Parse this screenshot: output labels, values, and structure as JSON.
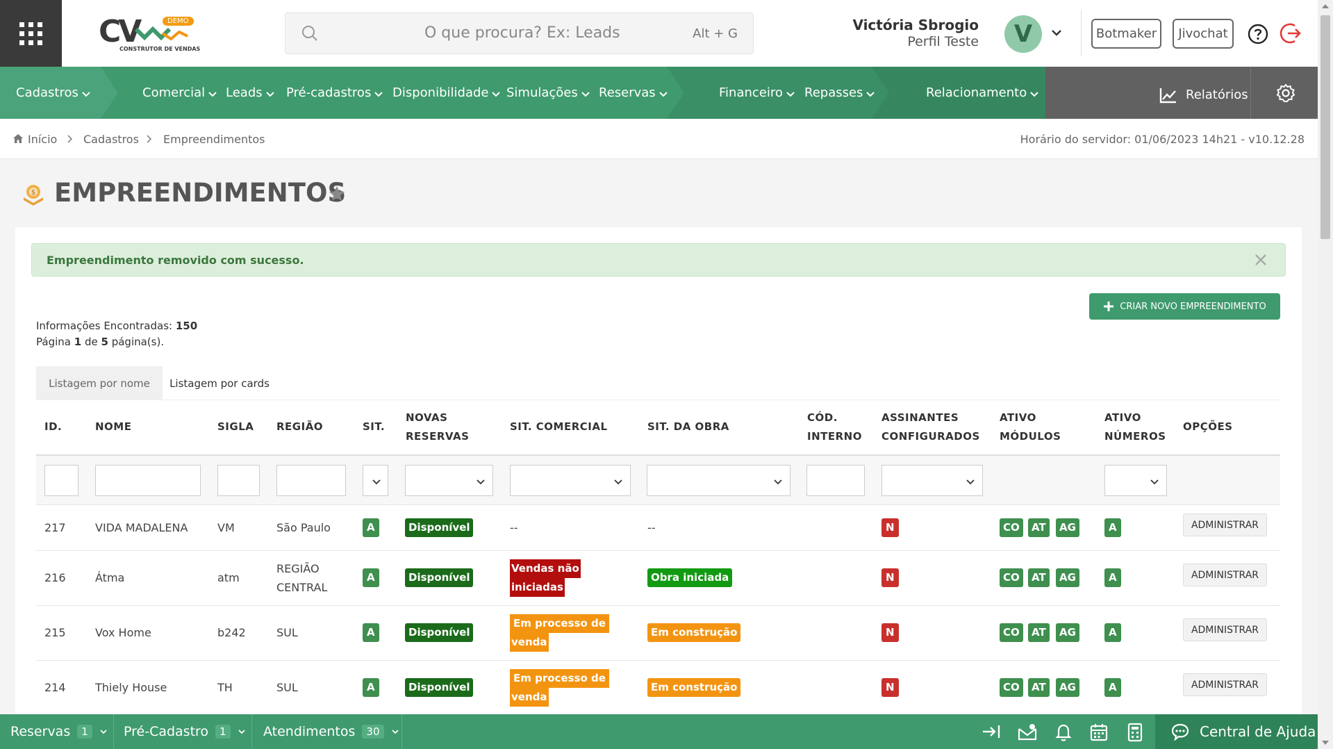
{
  "colors": {
    "brand_green": "#3f9a6e",
    "dark": "#3a3a3a",
    "nav_gray": "#616161",
    "danger": "#c9302c",
    "orange": "#f39411"
  },
  "header": {
    "logo_text": "CV",
    "logo_badge": "DEMO",
    "logo_subtitle": "CONSTRUTOR DE VENDAS",
    "search_placeholder": "O que procura? Ex: Leads",
    "search_shortcut": "Alt + G",
    "user_name": "Victória Sbrogio",
    "user_profile": "Perfil Teste",
    "avatar_initial": "V",
    "btn_botmaker": "Botmaker",
    "btn_jivochat": "Jivochat"
  },
  "nav": {
    "items": [
      {
        "label": "Cadastros"
      },
      {
        "label": "Comercial"
      },
      {
        "label": "Leads"
      },
      {
        "label": "Pré-cadastros"
      },
      {
        "label": "Disponibilidade"
      },
      {
        "label": "Simulações"
      },
      {
        "label": "Reservas"
      },
      {
        "label": "Financeiro"
      },
      {
        "label": "Repasses"
      },
      {
        "label": "Relacionamento"
      }
    ],
    "reports_label": "Relatórios"
  },
  "breadcrumb": {
    "home": "Início",
    "level1": "Cadastros",
    "level2": "Empreendimentos"
  },
  "server_time": "Horário do servidor: 01/06/2023 14h21 - v10.12.28",
  "page": {
    "title": "EMPREENDIMENTOS",
    "alert": "Empreendimento removido com sucesso.",
    "create_button": "CRIAR NOVO EMPREENDIMENTO",
    "info_found_label": "Informações Encontradas:",
    "info_found_value": "150",
    "page_word": "Página",
    "page_current": "1",
    "page_of": "de",
    "page_total": "5",
    "page_suffix": "página(s).",
    "tab_by_name": "Listagem por nome",
    "tab_by_cards": "Listagem por cards"
  },
  "table": {
    "headers": {
      "id": "ID.",
      "nome": "NOME",
      "sigla": "SIGLA",
      "regiao": "REGIÃO",
      "sit": "SIT.",
      "novas_1": "NOVAS",
      "novas_2": "RESERVAS",
      "sit_comercial": "SIT. COMERCIAL",
      "sit_obra": "SIT. DA OBRA",
      "cod_1": "CÓD.",
      "cod_2": "INTERNO",
      "assin_1": "ASSINANTES",
      "assin_2": "CONFIGURADOS",
      "mod_1": "ATIVO",
      "mod_2": "MÓDULOS",
      "num_1": "ATIVO",
      "num_2": "NÚMEROS",
      "opcoes": "OPÇÕES"
    },
    "rows": [
      {
        "id": "217",
        "nome": "VIDA MADALENA",
        "sigla": "VM",
        "regiao_1": "São Paulo",
        "regiao_2": "",
        "sit": "A",
        "novas": "Disponível",
        "sit_com_1": "--",
        "sit_com_2": "",
        "sit_obra": "--",
        "assin": "N",
        "mod_co": "CO",
        "mod_at": "AT",
        "mod_ag": "AG",
        "num": "A",
        "action": "ADMINISTRAR"
      },
      {
        "id": "216",
        "nome": "Átma",
        "sigla": "atm",
        "regiao_1": "REGIÃO",
        "regiao_2": "CENTRAL",
        "sit": "A",
        "novas": "Disponível",
        "sit_com_1": "Vendas não",
        "sit_com_2": "iniciadas",
        "sit_obra": "Obra iniciada",
        "assin": "N",
        "mod_co": "CO",
        "mod_at": "AT",
        "mod_ag": "AG",
        "num": "A",
        "action": "ADMINISTRAR"
      },
      {
        "id": "215",
        "nome": "Vox Home",
        "sigla": "b242",
        "regiao_1": "SUL",
        "regiao_2": "",
        "sit": "A",
        "novas": "Disponível",
        "sit_com_1": "Em processo de",
        "sit_com_2": "venda",
        "sit_obra": "Em construção",
        "assin": "N",
        "mod_co": "CO",
        "mod_at": "AT",
        "mod_ag": "AG",
        "num": "A",
        "action": "ADMINISTRAR"
      },
      {
        "id": "214",
        "nome": "Thiely House",
        "sigla": "TH",
        "regiao_1": "SUL",
        "regiao_2": "",
        "sit": "A",
        "novas": "Disponível",
        "sit_com_1": "Em processo de",
        "sit_com_2": "venda",
        "sit_obra": "Em construção",
        "assin": "N",
        "mod_co": "CO",
        "mod_at": "AT",
        "mod_ag": "AG",
        "num": "A",
        "action": "ADMINISTRAR"
      }
    ]
  },
  "bottombar": {
    "reservas_label": "Reservas",
    "reservas_count": "1",
    "precad_label": "Pré-Cadastro",
    "precad_count": "1",
    "atend_label": "Atendimentos",
    "atend_count": "30",
    "help_label": "Central de Ajuda"
  }
}
